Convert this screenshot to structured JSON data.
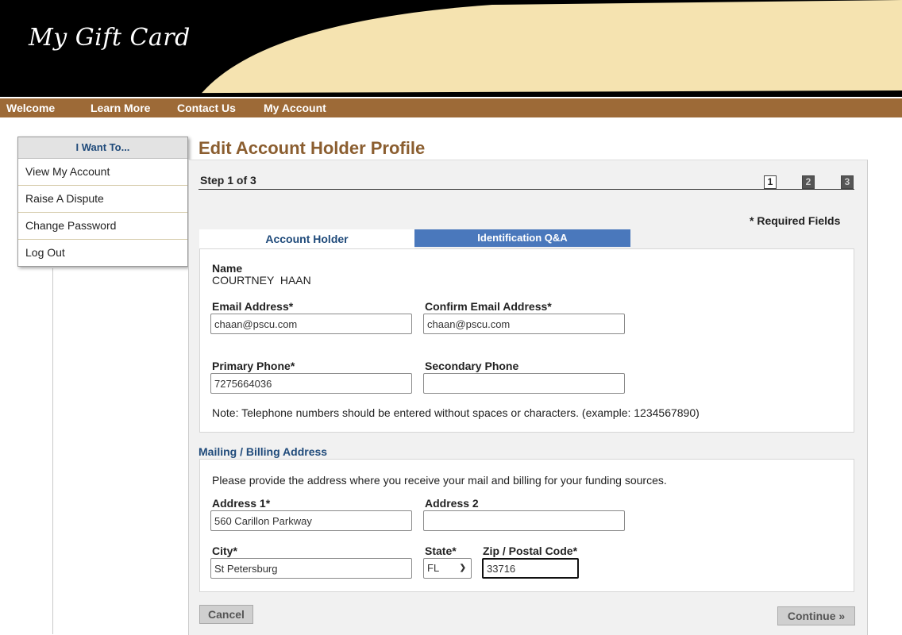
{
  "header": {
    "logo_text": "My Gift Card"
  },
  "nav": {
    "items": [
      "Welcome",
      "Learn More",
      "Contact Us",
      "My Account"
    ]
  },
  "sidebar": {
    "title": "I Want To...",
    "items": [
      "View My Account",
      "Raise A Dispute",
      "Change Password",
      "Log Out"
    ]
  },
  "page": {
    "title": "Edit Account Holder Profile",
    "step_label": "Step 1 of 3",
    "steps": [
      "1",
      "2",
      "3"
    ],
    "required_note": "* Required Fields"
  },
  "tabs": {
    "account_holder": "Account Holder",
    "identification": "Identification Q&A"
  },
  "account": {
    "name_label": "Name",
    "name_value": "COURTNEY  HAAN",
    "email_label": "Email Address*",
    "email_value": "chaan@pscu.com",
    "confirm_email_label": "Confirm Email Address*",
    "confirm_email_value": "chaan@pscu.com",
    "primary_phone_label": "Primary Phone*",
    "primary_phone_value": "7275664036",
    "secondary_phone_label": "Secondary Phone",
    "secondary_phone_value": "",
    "phone_note": "Note: Telephone numbers should be entered without spaces or characters. (example: 1234567890)"
  },
  "address": {
    "section_title": "Mailing / Billing Address",
    "intro": "Please provide the address where you receive your mail and billing for your funding sources.",
    "address1_label": "Address 1*",
    "address1_value": "560 Carillon Parkway",
    "address2_label": "Address 2",
    "address2_value": "",
    "city_label": "City*",
    "city_value": "St Petersburg",
    "state_label": "State*",
    "state_value": "FL",
    "zip_label": "Zip / Postal Code*",
    "zip_value": "33716"
  },
  "buttons": {
    "cancel": "Cancel",
    "continue": "Continue »"
  },
  "colors": {
    "brand_brown": "#9d6a37",
    "title_brown": "#8b5e30",
    "tab_blue": "#4a78bc",
    "cream": "#f5e3b0"
  }
}
